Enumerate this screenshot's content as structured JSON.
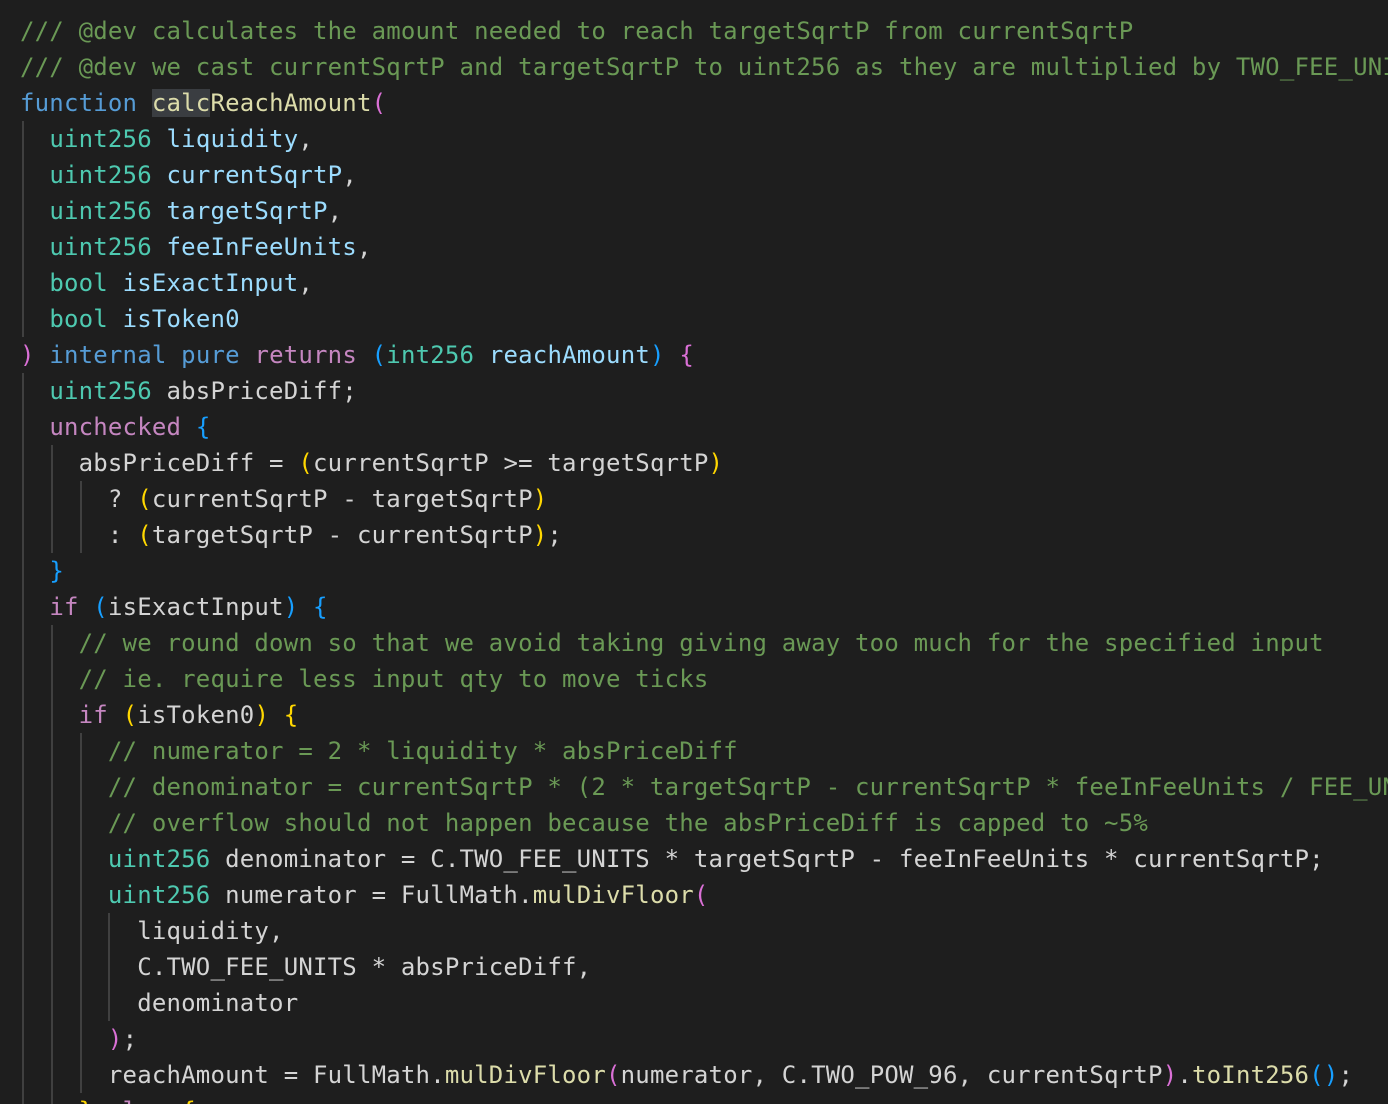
{
  "colors": {
    "background": "#1e1e1e",
    "comment": "#6a9955",
    "keyword": "#569cd6",
    "control": "#c586c0",
    "type": "#4ec9b0",
    "variable": "#9cdcfe",
    "function": "#dcdcaa",
    "plain": "#d4d4d4",
    "bracket1": "#ffd700",
    "bracket2": "#da70d6",
    "bracket3": "#179fff",
    "guide": "#404040",
    "word_highlight": "#3a3d41"
  },
  "lines": [
    {
      "indent": 0,
      "tokens": [
        {
          "t": "/// @dev calculates the amount needed to reach targetSqrtP from currentSqrtP",
          "c": "comment"
        }
      ]
    },
    {
      "indent": 0,
      "tokens": [
        {
          "t": "/// @dev we cast currentSqrtP and targetSqrtP to uint256 as they are multiplied by TWO_FEE_UNITS",
          "c": "comment"
        }
      ]
    },
    {
      "indent": 0,
      "tokens": [
        {
          "t": "function",
          "c": "keyword"
        },
        {
          "t": " ",
          "c": "plain"
        },
        {
          "t": "calc",
          "c": "function",
          "hl": true
        },
        {
          "t": "ReachAmount",
          "c": "function"
        },
        {
          "t": "(",
          "c": "bracket2"
        }
      ]
    },
    {
      "indent": 1,
      "tokens": [
        {
          "t": "uint256",
          "c": "type"
        },
        {
          "t": " ",
          "c": "plain"
        },
        {
          "t": "liquidity",
          "c": "variable"
        },
        {
          "t": ",",
          "c": "plain"
        }
      ]
    },
    {
      "indent": 1,
      "tokens": [
        {
          "t": "uint256",
          "c": "type"
        },
        {
          "t": " ",
          "c": "plain"
        },
        {
          "t": "currentSqrtP",
          "c": "variable"
        },
        {
          "t": ",",
          "c": "plain"
        }
      ]
    },
    {
      "indent": 1,
      "tokens": [
        {
          "t": "uint256",
          "c": "type"
        },
        {
          "t": " ",
          "c": "plain"
        },
        {
          "t": "targetSqrtP",
          "c": "variable"
        },
        {
          "t": ",",
          "c": "plain"
        }
      ]
    },
    {
      "indent": 1,
      "tokens": [
        {
          "t": "uint256",
          "c": "type"
        },
        {
          "t": " ",
          "c": "plain"
        },
        {
          "t": "feeInFeeUnits",
          "c": "variable"
        },
        {
          "t": ",",
          "c": "plain"
        }
      ]
    },
    {
      "indent": 1,
      "tokens": [
        {
          "t": "bool",
          "c": "type"
        },
        {
          "t": " ",
          "c": "plain"
        },
        {
          "t": "isExactInput",
          "c": "variable"
        },
        {
          "t": ",",
          "c": "plain"
        }
      ]
    },
    {
      "indent": 1,
      "tokens": [
        {
          "t": "bool",
          "c": "type"
        },
        {
          "t": " ",
          "c": "plain"
        },
        {
          "t": "isToken0",
          "c": "variable"
        }
      ]
    },
    {
      "indent": 0,
      "tokens": [
        {
          "t": ")",
          "c": "bracket2"
        },
        {
          "t": " ",
          "c": "plain"
        },
        {
          "t": "internal",
          "c": "keyword"
        },
        {
          "t": " ",
          "c": "plain"
        },
        {
          "t": "pure",
          "c": "keyword"
        },
        {
          "t": " ",
          "c": "plain"
        },
        {
          "t": "returns",
          "c": "control"
        },
        {
          "t": " ",
          "c": "plain"
        },
        {
          "t": "(",
          "c": "bracket3"
        },
        {
          "t": "int256",
          "c": "type"
        },
        {
          "t": " ",
          "c": "plain"
        },
        {
          "t": "reachAmount",
          "c": "variable"
        },
        {
          "t": ")",
          "c": "bracket3"
        },
        {
          "t": " ",
          "c": "plain"
        },
        {
          "t": "{",
          "c": "bracket2"
        }
      ]
    },
    {
      "indent": 1,
      "tokens": [
        {
          "t": "uint256",
          "c": "type"
        },
        {
          "t": " absPriceDiff;",
          "c": "plain"
        }
      ]
    },
    {
      "indent": 1,
      "tokens": [
        {
          "t": "unchecked",
          "c": "control"
        },
        {
          "t": " ",
          "c": "plain"
        },
        {
          "t": "{",
          "c": "bracket3"
        }
      ]
    },
    {
      "indent": 2,
      "tokens": [
        {
          "t": "absPriceDiff = ",
          "c": "plain"
        },
        {
          "t": "(",
          "c": "bracket1"
        },
        {
          "t": "currentSqrtP >= targetSqrtP",
          "c": "plain"
        },
        {
          "t": ")",
          "c": "bracket1"
        }
      ]
    },
    {
      "indent": 3,
      "tokens": [
        {
          "t": "? ",
          "c": "plain"
        },
        {
          "t": "(",
          "c": "bracket1"
        },
        {
          "t": "currentSqrtP - targetSqrtP",
          "c": "plain"
        },
        {
          "t": ")",
          "c": "bracket1"
        }
      ]
    },
    {
      "indent": 3,
      "tokens": [
        {
          "t": ": ",
          "c": "plain"
        },
        {
          "t": "(",
          "c": "bracket1"
        },
        {
          "t": "targetSqrtP - currentSqrtP",
          "c": "plain"
        },
        {
          "t": ")",
          "c": "bracket1"
        },
        {
          "t": ";",
          "c": "plain"
        }
      ]
    },
    {
      "indent": 1,
      "tokens": [
        {
          "t": "}",
          "c": "bracket3"
        }
      ]
    },
    {
      "indent": 1,
      "tokens": [
        {
          "t": "if",
          "c": "control"
        },
        {
          "t": " ",
          "c": "plain"
        },
        {
          "t": "(",
          "c": "bracket3"
        },
        {
          "t": "isExactInput",
          "c": "plain"
        },
        {
          "t": ")",
          "c": "bracket3"
        },
        {
          "t": " ",
          "c": "plain"
        },
        {
          "t": "{",
          "c": "bracket3"
        }
      ]
    },
    {
      "indent": 2,
      "tokens": [
        {
          "t": "// we round down so that we avoid taking giving away too much for the specified input",
          "c": "comment"
        }
      ]
    },
    {
      "indent": 2,
      "tokens": [
        {
          "t": "// ie. require less input qty to move ticks",
          "c": "comment"
        }
      ]
    },
    {
      "indent": 2,
      "tokens": [
        {
          "t": "if",
          "c": "control"
        },
        {
          "t": " ",
          "c": "plain"
        },
        {
          "t": "(",
          "c": "bracket1"
        },
        {
          "t": "isToken0",
          "c": "plain"
        },
        {
          "t": ")",
          "c": "bracket1"
        },
        {
          "t": " ",
          "c": "plain"
        },
        {
          "t": "{",
          "c": "bracket1"
        }
      ]
    },
    {
      "indent": 3,
      "tokens": [
        {
          "t": "// numerator = 2 * liquidity * absPriceDiff",
          "c": "comment"
        }
      ]
    },
    {
      "indent": 3,
      "tokens": [
        {
          "t": "// denominator = currentSqrtP * (2 * targetSqrtP - currentSqrtP * feeInFeeUnits / FEE_UNITS)",
          "c": "comment"
        }
      ]
    },
    {
      "indent": 3,
      "tokens": [
        {
          "t": "// overflow should not happen because the absPriceDiff is capped to ~5%",
          "c": "comment"
        }
      ]
    },
    {
      "indent": 3,
      "tokens": [
        {
          "t": "uint256",
          "c": "type"
        },
        {
          "t": " denominator = C.TWO_FEE_UNITS * targetSqrtP - feeInFeeUnits * currentSqrtP;",
          "c": "plain"
        }
      ]
    },
    {
      "indent": 3,
      "tokens": [
        {
          "t": "uint256",
          "c": "type"
        },
        {
          "t": " numerator = FullMath.",
          "c": "plain"
        },
        {
          "t": "mulDivFloor",
          "c": "function"
        },
        {
          "t": "(",
          "c": "bracket2"
        }
      ]
    },
    {
      "indent": 4,
      "tokens": [
        {
          "t": "liquidity,",
          "c": "plain"
        }
      ]
    },
    {
      "indent": 4,
      "tokens": [
        {
          "t": "C.TWO_FEE_UNITS * absPriceDiff,",
          "c": "plain"
        }
      ]
    },
    {
      "indent": 4,
      "tokens": [
        {
          "t": "denominator",
          "c": "plain"
        }
      ]
    },
    {
      "indent": 3,
      "tokens": [
        {
          "t": ")",
          "c": "bracket2"
        },
        {
          "t": ";",
          "c": "plain"
        }
      ]
    },
    {
      "indent": 3,
      "tokens": [
        {
          "t": "reachAmount = FullMath.",
          "c": "plain"
        },
        {
          "t": "mulDivFloor",
          "c": "function"
        },
        {
          "t": "(",
          "c": "bracket2"
        },
        {
          "t": "numerator, C.TWO_POW_96, currentSqrtP",
          "c": "plain"
        },
        {
          "t": ")",
          "c": "bracket2"
        },
        {
          "t": ".",
          "c": "plain"
        },
        {
          "t": "toInt256",
          "c": "function"
        },
        {
          "t": "(",
          "c": "bracket3"
        },
        {
          "t": ")",
          "c": "bracket3"
        },
        {
          "t": ";",
          "c": "plain"
        }
      ]
    },
    {
      "indent": 2,
      "tokens": [
        {
          "t": "}",
          "c": "bracket1"
        },
        {
          "t": " ",
          "c": "plain"
        },
        {
          "t": "else",
          "c": "control"
        },
        {
          "t": " ",
          "c": "plain"
        },
        {
          "t": "{",
          "c": "bracket1"
        }
      ]
    }
  ]
}
